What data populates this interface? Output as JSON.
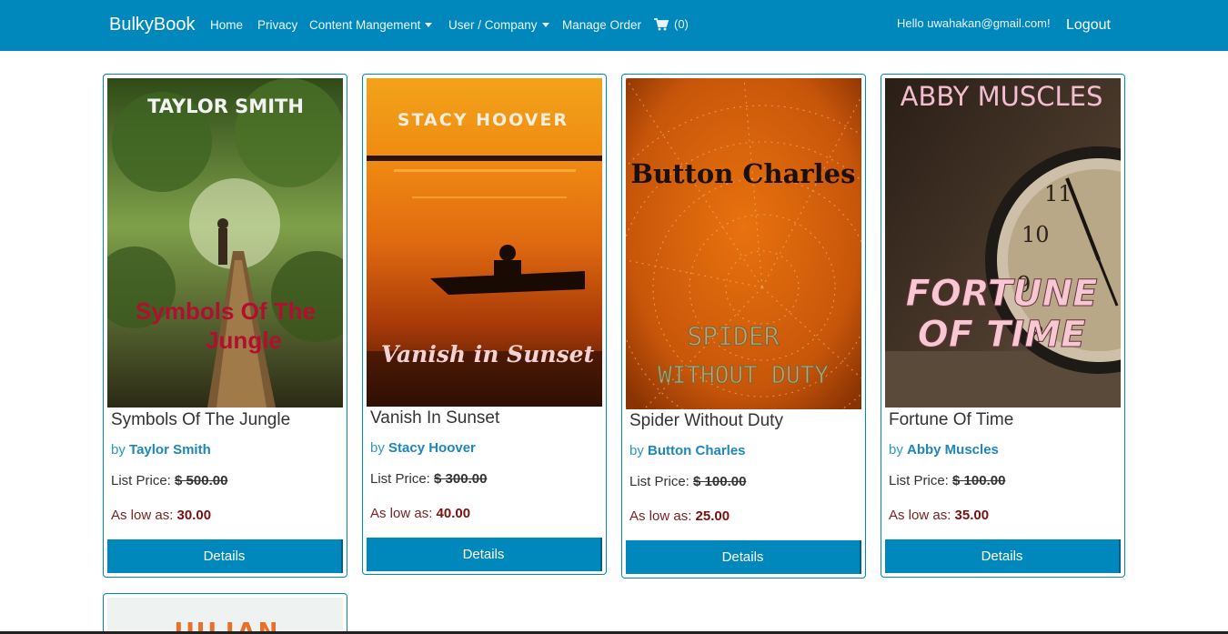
{
  "nav": {
    "brand": "BulkyBook",
    "home": "Home",
    "privacy": "Privacy",
    "content": "Content Mangement",
    "user_company": "User / Company",
    "manage_order": "Manage Order",
    "cart_count": "(0)",
    "hello": "Hello uwahakan@gmail.com!",
    "logout": "Logout"
  },
  "products": [
    {
      "cover_author": "TAYLOR SMITH",
      "cover_title_1": "Symbols Of The",
      "cover_title_2": "Jungle",
      "title": "Symbols Of The Jungle",
      "by": "by",
      "author": "Taylor Smith",
      "list_label": "List Price:",
      "list_price": "$ 500.00",
      "low_label": "As low as:",
      "low_price": "30.00",
      "button": "Details"
    },
    {
      "cover_author": "STACY HOOVER",
      "cover_title_1": "Vanish in Sunset",
      "title": "Vanish In Sunset",
      "by": "by",
      "author": "Stacy Hoover",
      "list_label": "List Price:",
      "list_price": "$ 300.00",
      "low_label": "As low as:",
      "low_price": "40.00",
      "button": "Details"
    },
    {
      "cover_author": "Button Charles",
      "cover_title_1": "SPIDER",
      "cover_title_2": "WITHOUT DUTY",
      "title": "Spider Without Duty",
      "by": "by",
      "author": "Button Charles",
      "list_label": "List Price:",
      "list_price": "$ 100.00",
      "low_label": "As low as:",
      "low_price": "25.00",
      "button": "Details"
    },
    {
      "cover_author": "ABBY MUSCLES",
      "cover_title_1": "FORTUNE",
      "cover_title_2": "OF TIME",
      "title": "Fortune Of Time",
      "by": "by",
      "author": "Abby Muscles",
      "list_label": "List Price:",
      "list_price": "$ 100.00",
      "low_label": "As low as:",
      "low_price": "35.00",
      "button": "Details"
    },
    {
      "cover_author": "JULIAN"
    }
  ],
  "colors": {
    "navbar": "#0088bd",
    "accent": "#0088bd",
    "author_link": "#1d86ba",
    "low_price": "#7a1010"
  },
  "icons": [
    "caret-down-icon",
    "cart-icon"
  ]
}
